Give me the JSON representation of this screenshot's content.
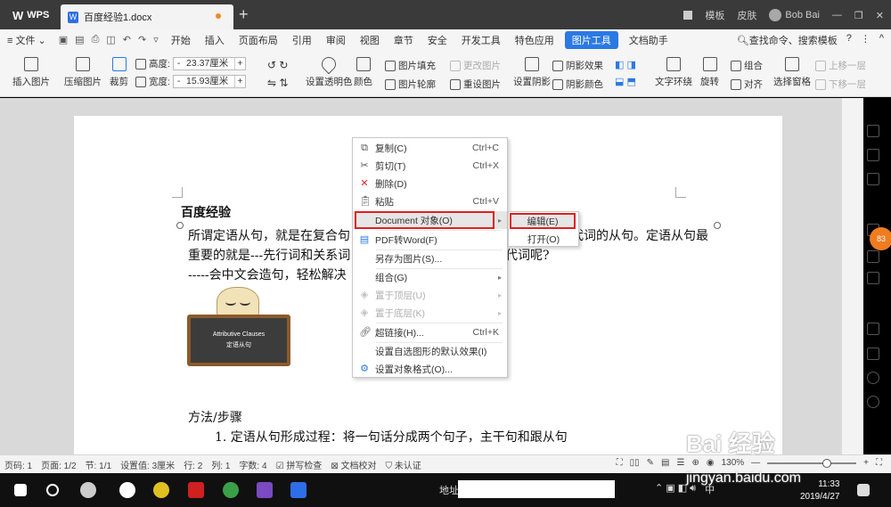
{
  "titlebar": {
    "app_name": "WPS",
    "doc_tab": "百度经验1.docx",
    "right_items": [
      "模板",
      "皮肤"
    ],
    "user": "Bob Bai"
  },
  "menubar": {
    "file": "文件",
    "tabs": [
      "开始",
      "插入",
      "页面布局",
      "引用",
      "审阅",
      "视图",
      "章节",
      "安全",
      "开发工具",
      "特色应用"
    ],
    "active_tab": "图片工具",
    "extra_tab": "文档助手",
    "search": "查找命令、搜索模板"
  },
  "ribbon": {
    "insert_picture": "插入图片",
    "compress_picture": "压缩图片",
    "crop": "裁剪",
    "height_label": "高度:",
    "height_value": "23.37厘米",
    "width_label": "宽度:",
    "width_value": "15.93厘米",
    "set_transparent": "设置透明色",
    "color": "颜色",
    "picture_fill": "图片填充",
    "picture_outline": "图片轮廓",
    "change_picture": "更改图片",
    "reset_picture": "重设图片",
    "set_shadow": "设置阴影",
    "shadow_effect": "阴影效果",
    "shadow_color": "阴影颜色",
    "text_wrap": "文字环绕",
    "rotate": "旋转",
    "group": "组合",
    "align": "对齐",
    "selection_pane": "选择窗格",
    "bring_forward": "上移一层",
    "send_backward": "下移一层"
  },
  "document": {
    "title": "百度经验",
    "para1": "所谓定语从句，就是在复合句",
    "para1_right": "代词的从句。定语从句最",
    "para2": "重要的就是---先行词和关系词",
    "para2_right": "关系代词呢?",
    "para3": "-----会中文会造句，轻松解决",
    "board_line1": "Attributive Clauses",
    "board_line2": "定语从句",
    "steps_heading": "方法/步骤",
    "step1": "1.   定语从句形成过程：将一句话分成两个句子，主干句和跟从句"
  },
  "context_menu": {
    "items": [
      {
        "label": "复制(C)",
        "key": "Ctrl+C",
        "icon": "copy-icon"
      },
      {
        "label": "剪切(T)",
        "key": "Ctrl+X",
        "icon": "scissors-icon"
      },
      {
        "label": "删除(D)",
        "key": "",
        "icon": "delete-icon"
      },
      {
        "label": "粘贴",
        "key": "Ctrl+V",
        "icon": "paste-icon"
      },
      {
        "label": "Document 对象(O)",
        "key": "",
        "icon": ""
      },
      {
        "label": "PDF转Word(F)",
        "key": "",
        "icon": "pdf-icon"
      },
      {
        "label": "另存为图片(S)...",
        "key": "",
        "icon": ""
      },
      {
        "label": "组合(G)",
        "key": "",
        "icon": ""
      },
      {
        "label": "置于顶层(U)",
        "key": "",
        "icon": "layer-up-icon"
      },
      {
        "label": "置于底层(K)",
        "key": "",
        "icon": "layer-down-icon"
      },
      {
        "label": "超链接(H)...",
        "key": "Ctrl+K",
        "icon": "link-icon"
      },
      {
        "label": "设置自选图形的默认效果(I)",
        "key": "",
        "icon": ""
      },
      {
        "label": "设置对象格式(O)...",
        "key": "",
        "icon": "format-icon"
      }
    ],
    "submenu": [
      "编辑(E)",
      "打开(O)"
    ]
  },
  "statusbar": {
    "items": [
      "页码: 1",
      "页面: 1/2",
      "节: 1/1",
      "设置值: 3厘米",
      "行: 2",
      "列: 1",
      "字数: 4",
      "拼写检查",
      "文档校对",
      "未认证"
    ],
    "zoom": "130%"
  },
  "taskbar": {
    "address_label": "地址",
    "ime": "中",
    "time": "11:33",
    "date": "2019/4/27"
  },
  "sidebar": {
    "badge": "83"
  },
  "watermark": {
    "brand": "Bai 经验",
    "url": "jingyan.baidu.com"
  },
  "colors": {
    "accent": "#2b79e4",
    "highlight_border": "#e02020",
    "badge": "#f07c1e"
  }
}
